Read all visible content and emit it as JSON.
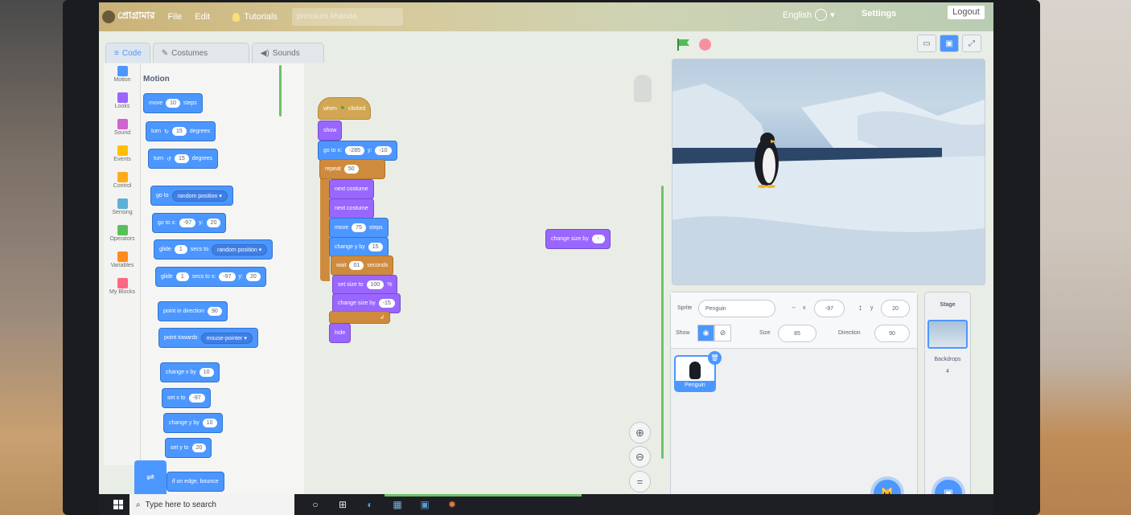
{
  "menubar": {
    "logo_text": "প্রোগ্রামার",
    "file": "File",
    "edit": "Edit",
    "tutorials": "Tutorials",
    "project_title": "premium khanda",
    "language": "English",
    "settings": "Settings",
    "logout": "Logout"
  },
  "tabs": [
    {
      "label": "Code",
      "icon": "code-icon"
    },
    {
      "label": "Costumes",
      "icon": "brush-icon"
    },
    {
      "label": "Sounds",
      "icon": "speaker-icon"
    }
  ],
  "categories": [
    {
      "label": "Motion",
      "color": "#4c97ff"
    },
    {
      "label": "Looks",
      "color": "#9966ff"
    },
    {
      "label": "Sound",
      "color": "#cf63cf"
    },
    {
      "label": "Events",
      "color": "#ffbf00"
    },
    {
      "label": "Control",
      "color": "#ffab19"
    },
    {
      "label": "Sensing",
      "color": "#5cb1d6"
    },
    {
      "label": "Operators",
      "color": "#59c059"
    },
    {
      "label": "Variables",
      "color": "#ff8c1a"
    },
    {
      "label": "My Blocks",
      "color": "#ff6680"
    }
  ],
  "palette": {
    "title": "Motion",
    "move": {
      "a": "move",
      "n": "10",
      "b": "steps"
    },
    "turn_cw": {
      "a": "turn",
      "n": "15",
      "b": "degrees"
    },
    "turn_ccw": {
      "a": "turn",
      "n": "15",
      "b": "degrees"
    },
    "goto": {
      "a": "go to",
      "dd": "random position"
    },
    "gotoxy": {
      "a": "go to x:",
      "x": "-97",
      "yl": "y:",
      "y": "20"
    },
    "glide1": {
      "a": "glide",
      "n": "1",
      "b": "secs to",
      "dd": "random position"
    },
    "glide2": {
      "a": "glide",
      "n": "1",
      "b": "secs to x:",
      "x": "-97",
      "yl": "y:",
      "y": "20"
    },
    "point_dir": {
      "a": "point in direction",
      "n": "90"
    },
    "point_towards": {
      "a": "point towards",
      "dd": "mouse-pointer"
    },
    "change_x": {
      "a": "change x by",
      "n": "10"
    },
    "set_x": {
      "a": "set x to",
      "n": "-97"
    },
    "change_y": {
      "a": "change y by",
      "n": "10"
    },
    "set_y": {
      "a": "set y to",
      "n": "20"
    },
    "bounce": {
      "a": "if on edge, bounce"
    }
  },
  "script": {
    "hat": {
      "a": "when",
      "b": "clicked"
    },
    "show": "show",
    "gotoxy": {
      "a": "go to x:",
      "x": "-285",
      "yl": "y:",
      "y": "-10"
    },
    "repeat": {
      "a": "repeat",
      "n": "50"
    },
    "next1": "next costume",
    "next2": "next costume",
    "move": {
      "a": "move",
      "n": "75",
      "b": "steps"
    },
    "change_y": {
      "a": "change y by",
      "n": "15"
    },
    "wait": {
      "a": "wait",
      "n": "01",
      "b": "seconds"
    },
    "set_size": {
      "a": "set size to",
      "n": "100",
      "b": "%"
    },
    "change_size": {
      "a": "change size by",
      "n": "-15"
    },
    "hide": "hide",
    "loose": {
      "a": "change size by",
      "n": "-"
    }
  },
  "sprite_info": {
    "sprite_label": "Sprite",
    "sprite_name": "Penguin",
    "x_label": "x",
    "x_value": "-97",
    "y_label": "y",
    "y_value": "20",
    "show_label": "Show",
    "size_label": "Size",
    "size_value": "85",
    "direction_label": "Direction",
    "direction_value": "90"
  },
  "sprite_list": [
    {
      "name": "Penguin"
    }
  ],
  "stage_panel": {
    "title": "Stage",
    "backdrops_label": "Backdrops",
    "backdrops_count": "4"
  },
  "taskbar": {
    "search_placeholder": "Type here to search"
  }
}
